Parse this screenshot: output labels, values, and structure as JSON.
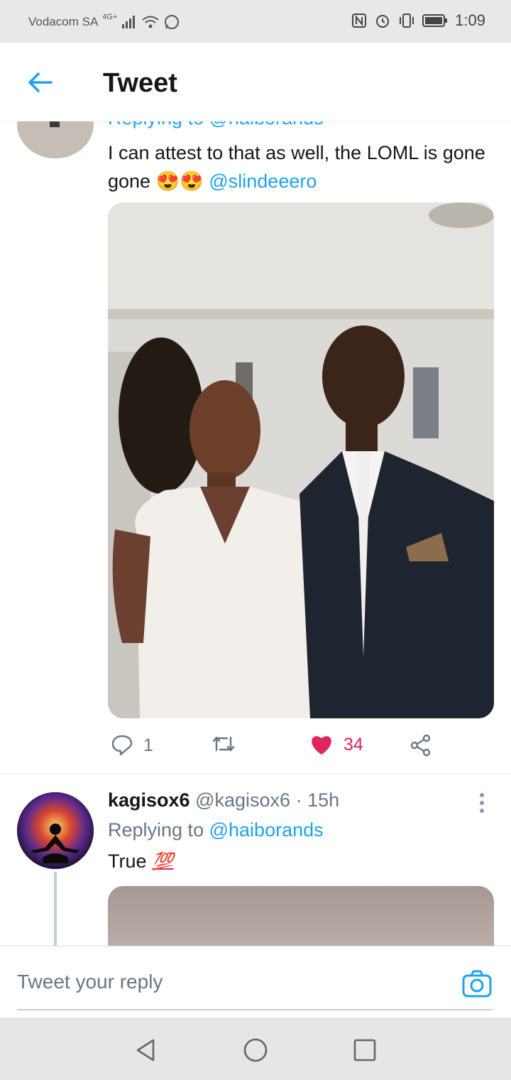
{
  "status_bar": {
    "carrier": "Vodacom SA",
    "network": "4G+",
    "time": "1:09"
  },
  "header": {
    "title": "Tweet"
  },
  "tweet1": {
    "replying_partial": "Replying to @haiborands",
    "text": "I can attest to that as well, the LOML is gone gone",
    "emojis": "😍😍",
    "mention": "@slindeeero",
    "reply_count": "1",
    "like_count": "34",
    "liked": true
  },
  "tweet2": {
    "display_name": "kagisox6",
    "handle": "@kagisox6",
    "time_sep": "·",
    "time": "15h",
    "replying_prefix": "Replying to",
    "replying_handle": "@haiborands",
    "text": "True",
    "emoji": "💯"
  },
  "composer": {
    "placeholder": "Tweet your reply"
  },
  "colors": {
    "accent": "#1da1f2",
    "like": "#e0245e",
    "text_secondary": "#657786"
  }
}
